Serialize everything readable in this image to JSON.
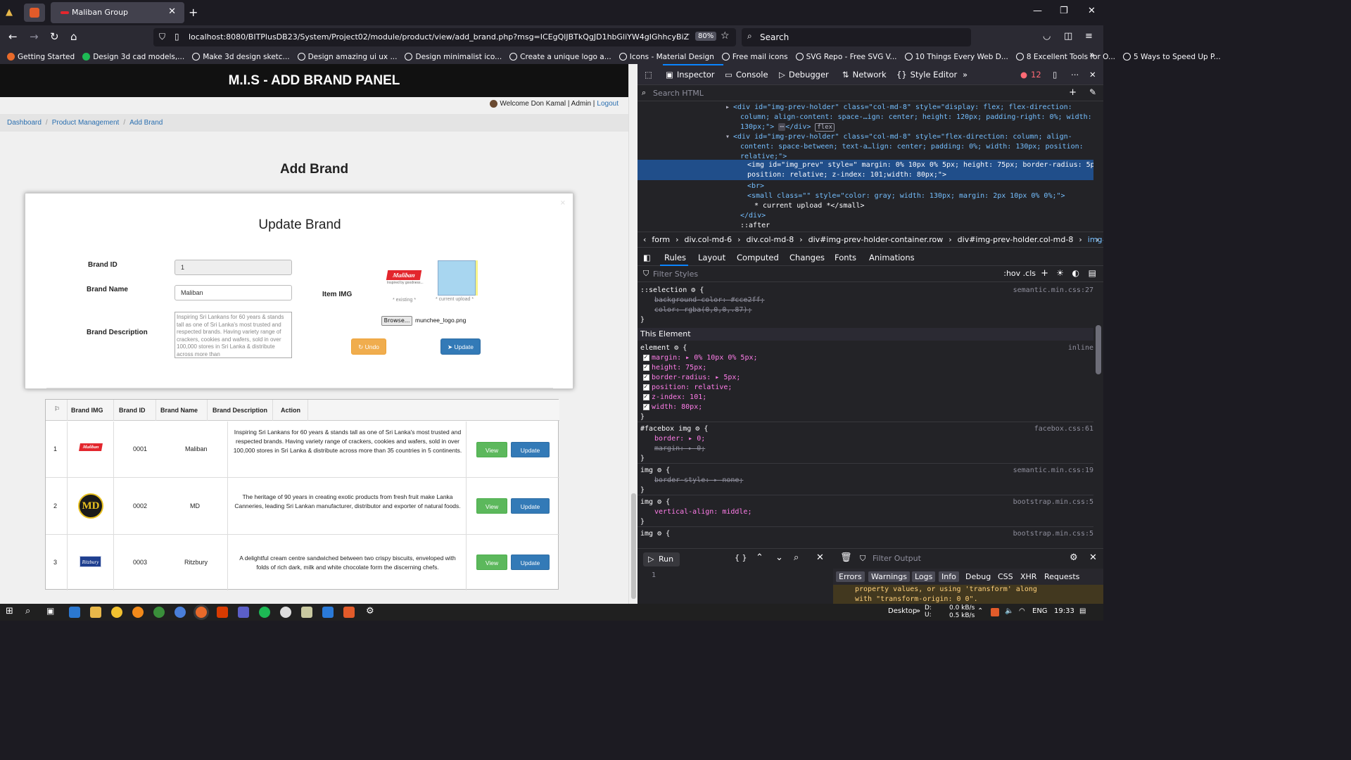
{
  "browser": {
    "tab_title": "Maliban Group",
    "url": "localhost:8080/BITPlusDB23/System/Project02/module/product/view/add_brand.php?msg=ICEgQlJBTkQgJD1hbGliYW4gIGhhcyBiZWVuIFVQRE",
    "url_host": "localhost",
    "zoom": "80%",
    "search_placeholder": "Search",
    "bookmarks": [
      "Getting Started",
      "Design 3d cad models,...",
      "Make 3d design sketc...",
      "Design amazing ui ux ...",
      "Design minimalist ico...",
      "Create a unique logo a...",
      "Icons - Material Design",
      "Free mail icons",
      "SVG Repo - Free SVG V...",
      "10 Things Every Web D...",
      "8 Excellent Tools for O...",
      "5 Ways to Speed Up P..."
    ]
  },
  "page": {
    "header_title": "M.I.S - ADD BRAND PANEL",
    "welcome": "Welcome Don Kamal | Admin |",
    "logout": "Logout",
    "breadcrumb": [
      "Dashboard",
      "Product Management",
      "Add Brand"
    ],
    "heading": "Add Brand",
    "modal": {
      "close": "×",
      "title": "Update Brand",
      "brand_id_label": "Brand ID",
      "brand_id_value": "1",
      "brand_name_label": "Brand Name",
      "brand_name_value": "Maliban",
      "brand_desc_label": "Brand Description",
      "brand_desc_value": "Inspiring Sri Lankans for 60 years & stands tall as one of Sri Lanka's most trusted and respected brands. Having variety range of crackers, cookies and wafers, sold in over 100,000 stores in Sri Lanka & distribute across more than",
      "item_img_label": "Item IMG",
      "logo_text": "Maliban",
      "logo_tagline": "Inspired by goodness...",
      "existing_caption": "* existing *",
      "current_caption": "* current upload *",
      "browse": "Browse...",
      "file_name": "munchee_logo.png",
      "undo": "Undo",
      "update": "Update"
    },
    "table": {
      "headers": [
        "Brand IMG",
        "Brand ID",
        "Brand Name",
        "Brand Description",
        "Action"
      ],
      "rows": [
        {
          "no": "1",
          "id": "0001",
          "name": "Maliban",
          "desc": "Inspiring Sri Lankans for 60 years & stands tall as one of Sri Lanka's most trusted and respected brands. Having variety range of crackers, cookies and wafers, sold in over 100,000 stores in Sri Lanka & distribute across more than 35 countries in 5 continents.",
          "view": "View",
          "update": "Update"
        },
        {
          "no": "2",
          "id": "0002",
          "name": "MD",
          "desc": "The heritage of 90 years in creating exotic products from fresh fruit make Lanka Canneries, leading Sri Lankan manufacturer, distributor and exporter of natural foods.",
          "view": "View",
          "update": "Update"
        },
        {
          "no": "3",
          "id": "0003",
          "name": "Ritzbury",
          "desc": "A delightful cream centre sandwiched between two crispy biscuits, enveloped with folds of rich dark, milk and white chocolate form the discerning chefs.",
          "view": "View",
          "update": "Update"
        }
      ],
      "logo_md": "MD",
      "logo_ritzbury": "Ritzbury"
    }
  },
  "devtools": {
    "tabs": [
      "Inspector",
      "Console",
      "Debugger",
      "Network",
      "Style Editor"
    ],
    "error_count": "12",
    "search_placeholder": "Search HTML",
    "markup": {
      "l1": "<div id=\"img-prev-holder\" class=\"col-md-8\" style=\"display: flex; flex-direction:",
      "l2": "column; align-content: space-…ign: center; height: 120px; padding-right: 0%; width:",
      "l3": "130px;\">",
      "l3_badge": "flex",
      "l4": "<div id=\"img-prev-holder\" class=\"col-md-8\" style=\"flex-direction: column; align-",
      "l5": "content: space-between; text-a…lign: center; padding: 0%; width: 130px; position:",
      "l6": "relative;\">",
      "l7": "<img id=\"img_prev\" style=\" margin: 0% 10px 0% 5px; height: 75px; border-radius: 5px;",
      "l8": "position: relative; z-index: 101;width: 80px;\">",
      "l9": "<br>",
      "l10": "<small class=\"\" style=\"color: gray; width: 130px; margin: 2px 10px 0% 0%;\">",
      "l11": "* current upload *</small>",
      "l12": "</div>",
      "l13": "::after"
    },
    "breadcrumb": [
      "form",
      "div.col-md-6",
      "div.col-md-8",
      "div#img-prev-holder-container.row",
      "div#img-prev-holder.col-md-8",
      "img#img_prev"
    ],
    "subtabs": [
      "Rules",
      "Layout",
      "Computed",
      "Changes",
      "Fonts",
      "Animations"
    ],
    "filter_placeholder": "Filter Styles",
    "filter_right": ":hov  .cls",
    "rules": {
      "sel_selection": "::selection",
      "src_selection": "semantic.min.css:27",
      "r1": "background-color: #cce2ff;",
      "r2": "color: rgba(0,0,0,.87);",
      "this_element": "This Element",
      "element": "element",
      "src_inline": "inline",
      "e1": "margin: ▸ 0% 10px 0% 5px;",
      "e2": "height: 75px;",
      "e3": "border-radius: ▸ 5px;",
      "e4": "position: relative;",
      "e5": "z-index: 101;",
      "e6": "width: 80px;",
      "sel_facebox": "#facebox img",
      "src_facebox": "facebox.css:61",
      "f1": "border: ▸ 0;",
      "f2": "margin: ▸ 0;",
      "sel_img": "img",
      "src_semantic19": "semantic.min.css:19",
      "i1": "border-style: ▸ none;",
      "src_bootstrap": "bootstrap.min.css:5",
      "i2": "vertical-align: middle;"
    },
    "console": {
      "run": "Run",
      "filter_placeholder": "Filter Output",
      "line": "1",
      "tabs": [
        "Errors",
        "Warnings",
        "Logs",
        "Info",
        "Debug",
        "CSS",
        "XHR",
        "Requests"
      ],
      "warning_l1": "property values, or using 'transform' along",
      "warning_l2": "with \"transform-origin: 0 0\"."
    }
  },
  "taskbar": {
    "desktop": "Desktop",
    "drives": "D:\nU:",
    "net_down": "0.0 kB/s",
    "net_up": "0.5 kB/s",
    "lang": "ENG",
    "time": "19:33"
  }
}
